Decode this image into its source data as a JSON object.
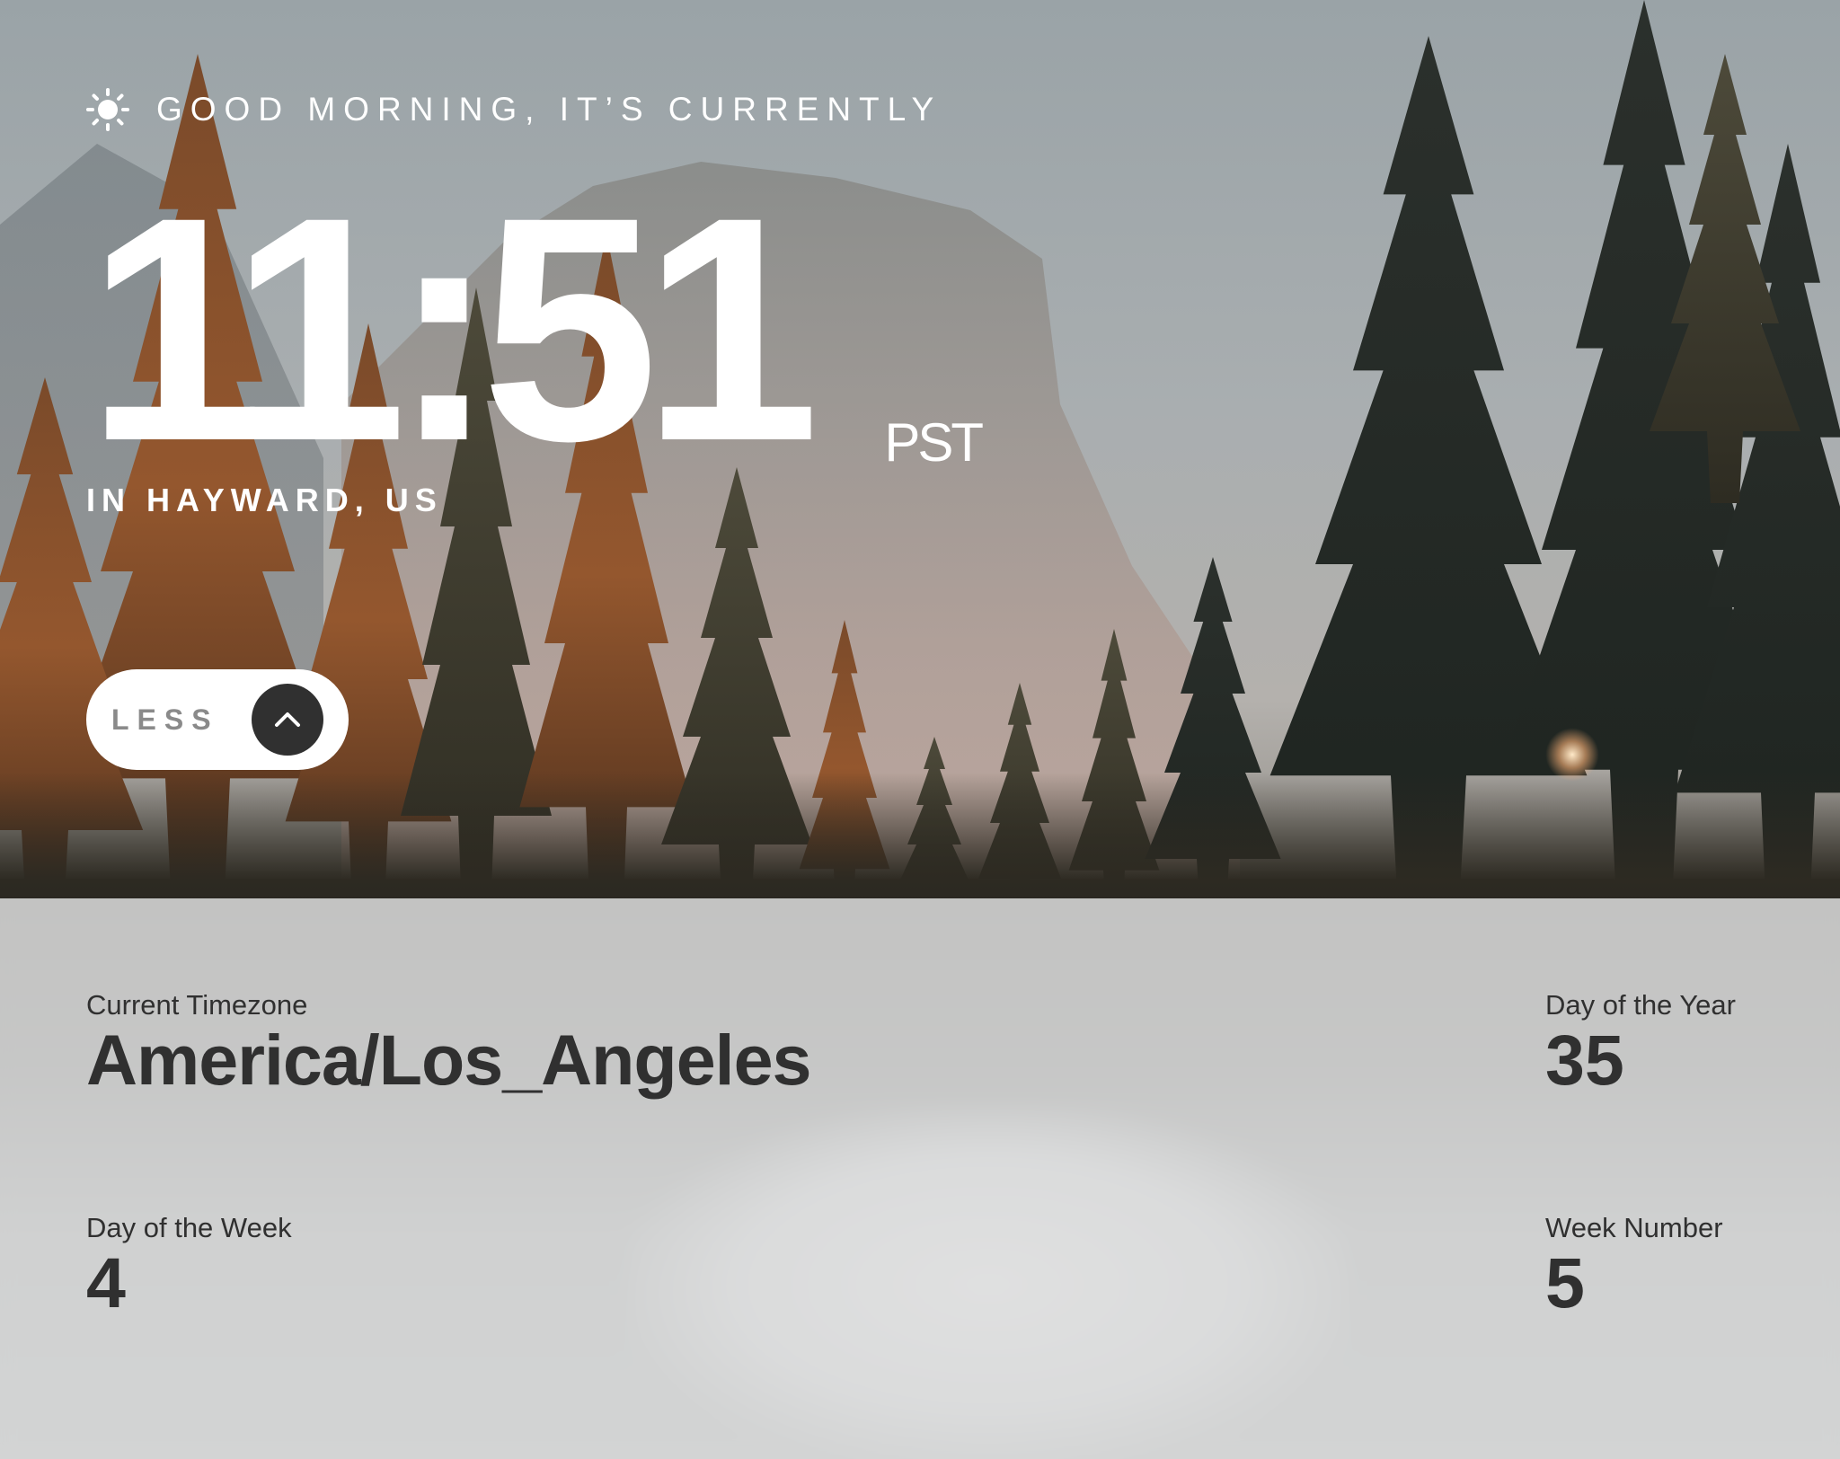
{
  "header": {
    "greeting": "GOOD MORNING, IT’S CURRENTLY",
    "greeting_icon": "sun-icon"
  },
  "clock": {
    "time": "11:51",
    "zone_abbr": "PST",
    "location": "IN HAYWARD, US"
  },
  "toggle": {
    "label": "LESS",
    "icon": "chevron-up-icon"
  },
  "details": {
    "timezone_label": "Current Timezone",
    "timezone_value": "America/Los_Angeles",
    "day_of_year_label": "Day of the Year",
    "day_of_year_value": "35",
    "day_of_week_label": "Day of the Week",
    "day_of_week_value": "4",
    "week_number_label": "Week Number",
    "week_number_value": "5"
  },
  "colors": {
    "panel_text": "#303030",
    "toggle_circle": "#303030",
    "toggle_label": "#8a8a8a",
    "clock_text": "#ffffff"
  }
}
